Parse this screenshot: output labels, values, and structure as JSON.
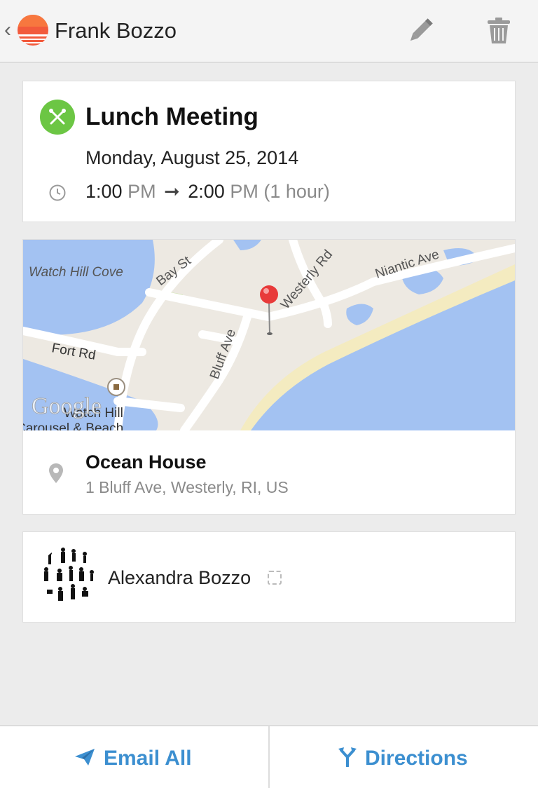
{
  "appbar": {
    "title": "Frank Bozzo",
    "back_icon": "chevron-left-icon",
    "logo_icon": "sunrise-logo-icon",
    "edit_icon": "pencil-icon",
    "delete_icon": "trash-icon"
  },
  "event": {
    "category_icon": "fork-knife-icon",
    "category_color": "#6cc644",
    "title": "Lunch Meeting",
    "date": "Monday, August 25, 2014",
    "start_time": "1:00",
    "start_period": "PM",
    "end_time": "2:00",
    "end_period": "PM",
    "duration": "(1 hour)"
  },
  "location": {
    "map_labels": {
      "cove": "Watch Hill Cove",
      "bay_st": "Bay St",
      "westerly_rd": "Westerly Rd",
      "niantic_ave": "Niantic Ave",
      "fort_rd": "Fort Rd",
      "bluff_ave": "Bluff Ave",
      "watch_hill": "Watch Hill",
      "carousel": "Carousel & Beach",
      "watermark": "Google"
    },
    "name": "Ocean House",
    "address": "1 Bluff Ave, Westerly, RI, US"
  },
  "attendees": [
    {
      "name": "Alexandra Bozzo",
      "status_icon": "rsvp-unknown-icon"
    }
  ],
  "actions": {
    "email_label": "Email All",
    "directions_label": "Directions",
    "accent_color": "#3c8fd0"
  }
}
